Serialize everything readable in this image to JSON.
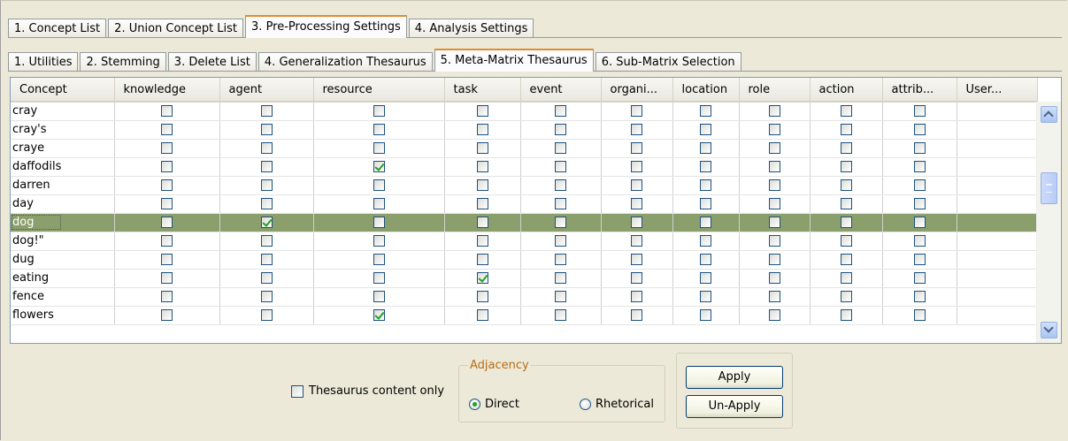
{
  "main_tabs": [
    {
      "label": "1. Concept List",
      "active": false
    },
    {
      "label": "2. Union Concept List",
      "active": false
    },
    {
      "label": "3. Pre-Processing Settings",
      "active": true
    },
    {
      "label": "4. Analysis Settings",
      "active": false
    }
  ],
  "sub_tabs": [
    {
      "label": "1. Utilities",
      "active": false
    },
    {
      "label": "2. Stemming",
      "active": false
    },
    {
      "label": "3. Delete List",
      "active": false
    },
    {
      "label": "4. Generalization Thesaurus",
      "active": false
    },
    {
      "label": "5. Meta-Matrix Thesaurus",
      "active": true
    },
    {
      "label": "6. Sub-Matrix Selection",
      "active": false
    }
  ],
  "table": {
    "columns": [
      "Concept",
      "knowledge",
      "agent",
      "resource",
      "task",
      "event",
      "organi...",
      "location",
      "role",
      "action",
      "attrib...",
      "User..."
    ],
    "rows": [
      {
        "concept": "cray",
        "checked": []
      },
      {
        "concept": "cray's",
        "checked": []
      },
      {
        "concept": "craye",
        "checked": []
      },
      {
        "concept": "daffodils",
        "checked": [
          "resource"
        ]
      },
      {
        "concept": "darren",
        "checked": []
      },
      {
        "concept": "day",
        "checked": []
      },
      {
        "concept": "dog",
        "checked": [
          "agent"
        ],
        "selected": true
      },
      {
        "concept": "dog!\"",
        "checked": []
      },
      {
        "concept": "dug",
        "checked": []
      },
      {
        "concept": "eating",
        "checked": [
          "task"
        ]
      },
      {
        "concept": "fence",
        "checked": []
      },
      {
        "concept": "flowers",
        "checked": [
          "resource"
        ]
      }
    ]
  },
  "bottom": {
    "thesaurus_only_label": "Thesaurus content only",
    "thesaurus_only_checked": false,
    "adjacency": {
      "legend": "Adjacency",
      "options": [
        {
          "label": "Direct",
          "selected": true
        },
        {
          "label": "Rhetorical",
          "selected": false
        }
      ]
    },
    "apply_label": "Apply",
    "unapply_label": "Un-Apply"
  },
  "colors": {
    "active_tab_accent": "#e68b2c",
    "selected_row": "#8b9f6c",
    "check_mark": "#21a121",
    "legend_text": "#b86d15"
  },
  "icons": [
    "scroll-up-arrow-icon",
    "scroll-down-arrow-icon",
    "checkmark-icon",
    "radio-dot-icon"
  ]
}
